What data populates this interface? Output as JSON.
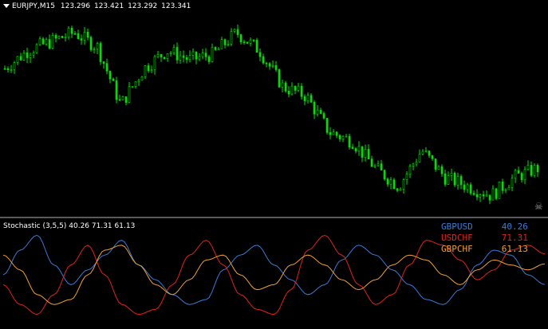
{
  "chart_header": {
    "symbol_tf": "EURJPY,M15",
    "open": "123.296",
    "high": "123.421",
    "low": "123.292",
    "close": "123.341"
  },
  "indicator_header": {
    "label": "Stochastic (3,5,5)",
    "v1": "40.26",
    "v2": "71.31",
    "v3": "61.13"
  },
  "legend": [
    {
      "name": "GBPUSD",
      "value": "40.26",
      "color": "#3a7bd5"
    },
    {
      "name": "USDCHF",
      "value": "71.31",
      "color": "#e0221f"
    },
    {
      "name": "GBPCHF",
      "value": "61.13",
      "color": "#f0a030"
    }
  ],
  "colors": {
    "background": "#000000",
    "candles": "#00e000",
    "separator": "#5a5a5a",
    "text": "#ffffff"
  },
  "icons": {
    "menu_arrow": "triangle-down-icon",
    "skull": "skull-icon"
  },
  "chart_data": {
    "type": "line",
    "price_trend": [
      123.2,
      123.3,
      123.35,
      123.4,
      123.32,
      123.0,
      123.2,
      123.3,
      123.25,
      123.28,
      123.4,
      123.3,
      123.1,
      123.05,
      122.85,
      122.8,
      122.65,
      122.55,
      122.75,
      122.6,
      122.55,
      122.5,
      122.6,
      122.65
    ],
    "series": [
      {
        "name": "GBPUSD",
        "values": [
          50,
          75,
          90,
          60,
          40,
          55,
          70,
          85,
          60,
          45,
          30,
          20,
          25,
          55,
          70,
          80,
          60,
          45,
          30,
          40,
          65,
          80,
          70,
          55,
          40,
          25,
          20,
          35,
          60,
          75,
          70,
          50,
          40.26
        ]
      },
      {
        "name": "USDCHF",
        "values": [
          40,
          20,
          10,
          30,
          60,
          80,
          50,
          20,
          10,
          15,
          40,
          70,
          85,
          60,
          30,
          15,
          10,
          35,
          75,
          90,
          70,
          40,
          20,
          30,
          60,
          85,
          80,
          65,
          45,
          55,
          75,
          80,
          71.31
        ]
      },
      {
        "name": "GBPCHF",
        "values": [
          70,
          55,
          30,
          20,
          25,
          50,
          75,
          80,
          60,
          40,
          30,
          45,
          65,
          70,
          50,
          35,
          40,
          60,
          70,
          60,
          45,
          35,
          45,
          60,
          70,
          65,
          50,
          40,
          55,
          65,
          60,
          55,
          61.13
        ]
      }
    ],
    "ylim": [
      0,
      100
    ]
  }
}
